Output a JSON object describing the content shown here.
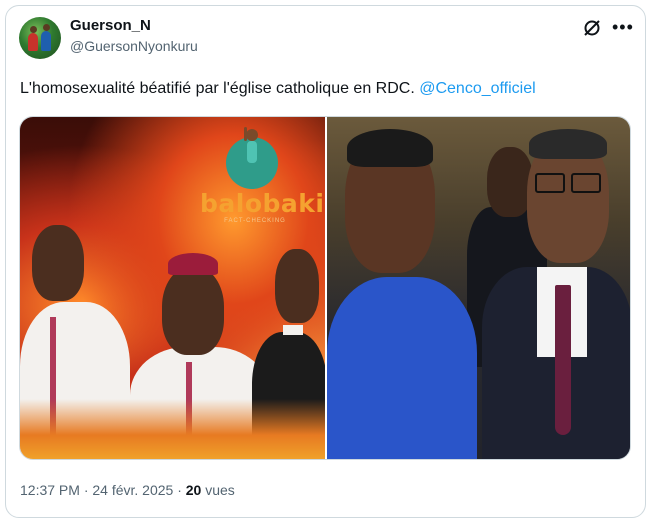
{
  "author": {
    "name": "Guerson_N",
    "handle": "@GuersonNyonkuru"
  },
  "tweet": {
    "text": "L'homosexualité béatifié par l'église catholique en RDC.",
    "mention": "@Cenco_officiel"
  },
  "media": {
    "left_image": "image-left",
    "right_image": "image-right",
    "logo_text": "balobaki",
    "logo_subtext": "FACT-CHECKING"
  },
  "meta": {
    "time_date": "12:37 PM · 24 févr. 2025 ·",
    "views_count": "20",
    "views_label": "vues"
  },
  "colors": {
    "link": "#1d9bf0",
    "secondary_text": "#536471",
    "logo_orange": "#f5a230",
    "logo_teal": "#2f9c8a"
  }
}
